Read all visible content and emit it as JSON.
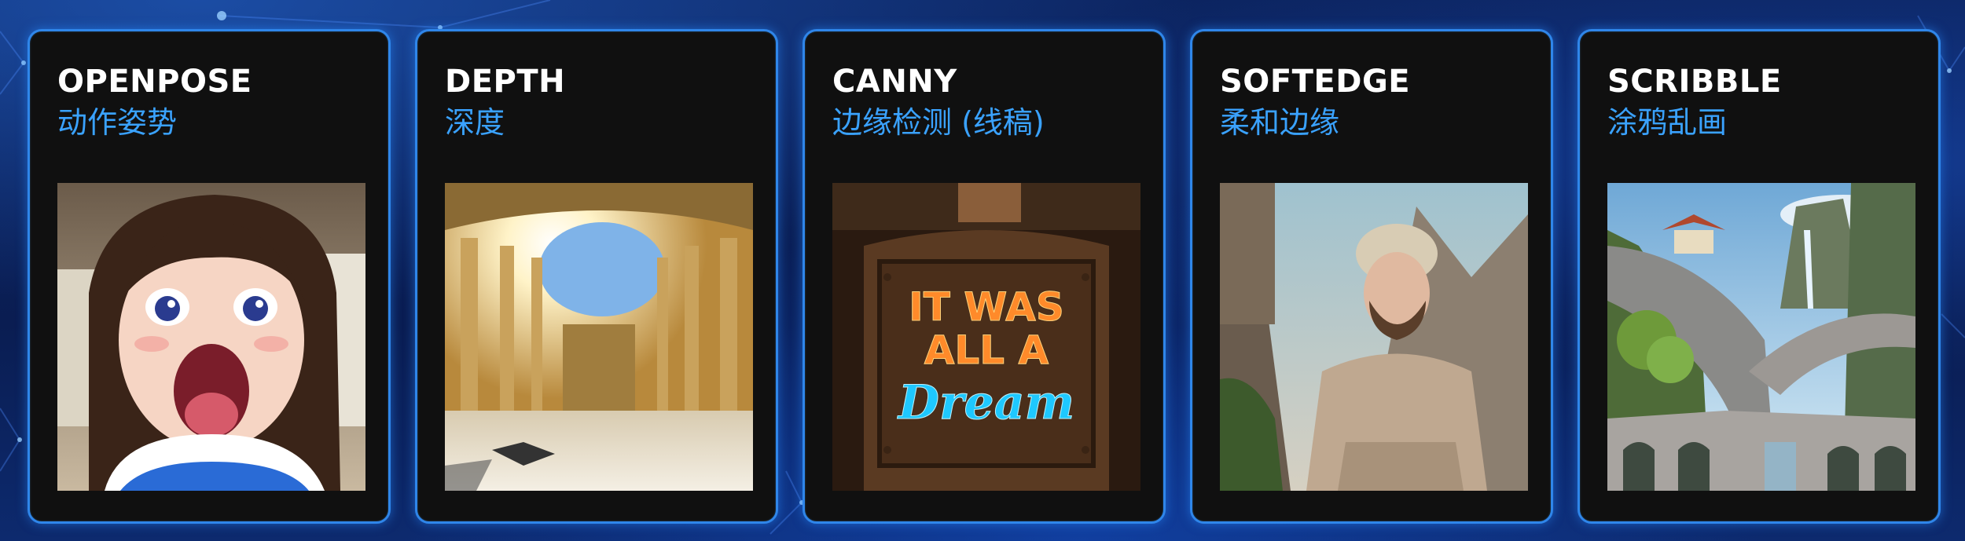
{
  "cards": [
    {
      "title": "OPENPOSE",
      "subtitle": "动作姿势",
      "image": "anime-girl-open-mouth-image"
    },
    {
      "title": "DEPTH",
      "subtitle": "深度",
      "image": "palace-colonnade-image"
    },
    {
      "title": "CANNY",
      "subtitle": "边缘检测 (线稿)",
      "image": "neon-sign-image",
      "sign_text": [
        "IT WAS",
        "ALL A",
        "Dream"
      ]
    },
    {
      "title": "SOFTEDGE",
      "subtitle": "柔和边缘",
      "image": "man-in-beanie-image"
    },
    {
      "title": "SCRIBBLE",
      "subtitle": "涂鸦乱画",
      "image": "fantasy-landscape-image"
    }
  ],
  "colors": {
    "card_border": "#2f86ea",
    "subtitle": "#3aa2ff",
    "title": "#ffffff",
    "card_bg": "#101010"
  }
}
